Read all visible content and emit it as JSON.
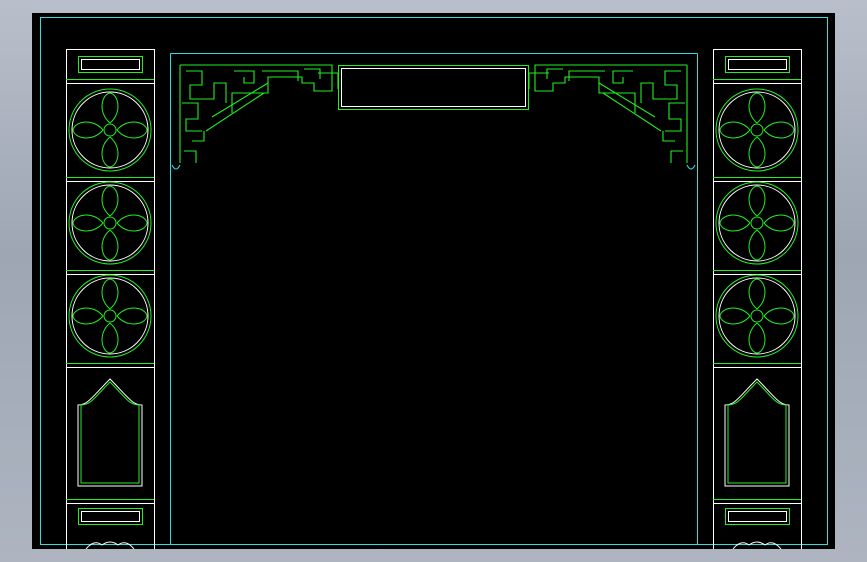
{
  "drawing": {
    "colors": {
      "background": "#000000",
      "frame_line": "#33dddd",
      "structure_line": "#ffffff",
      "ornament_line": "#22ee22"
    },
    "elements": {
      "outer_frame": "rectangle-frame",
      "archway": "open-doorway",
      "lintel": "fret-pattern-lintel",
      "plaque": "blank-plaque",
      "left_pillar": "carved-pillar",
      "right_pillar": "carved-pillar",
      "roundel_motif": "four-petal-flower-in-circle",
      "niche_motif": "ogee-arched-niche"
    },
    "pillar_roundel_count": 3
  }
}
